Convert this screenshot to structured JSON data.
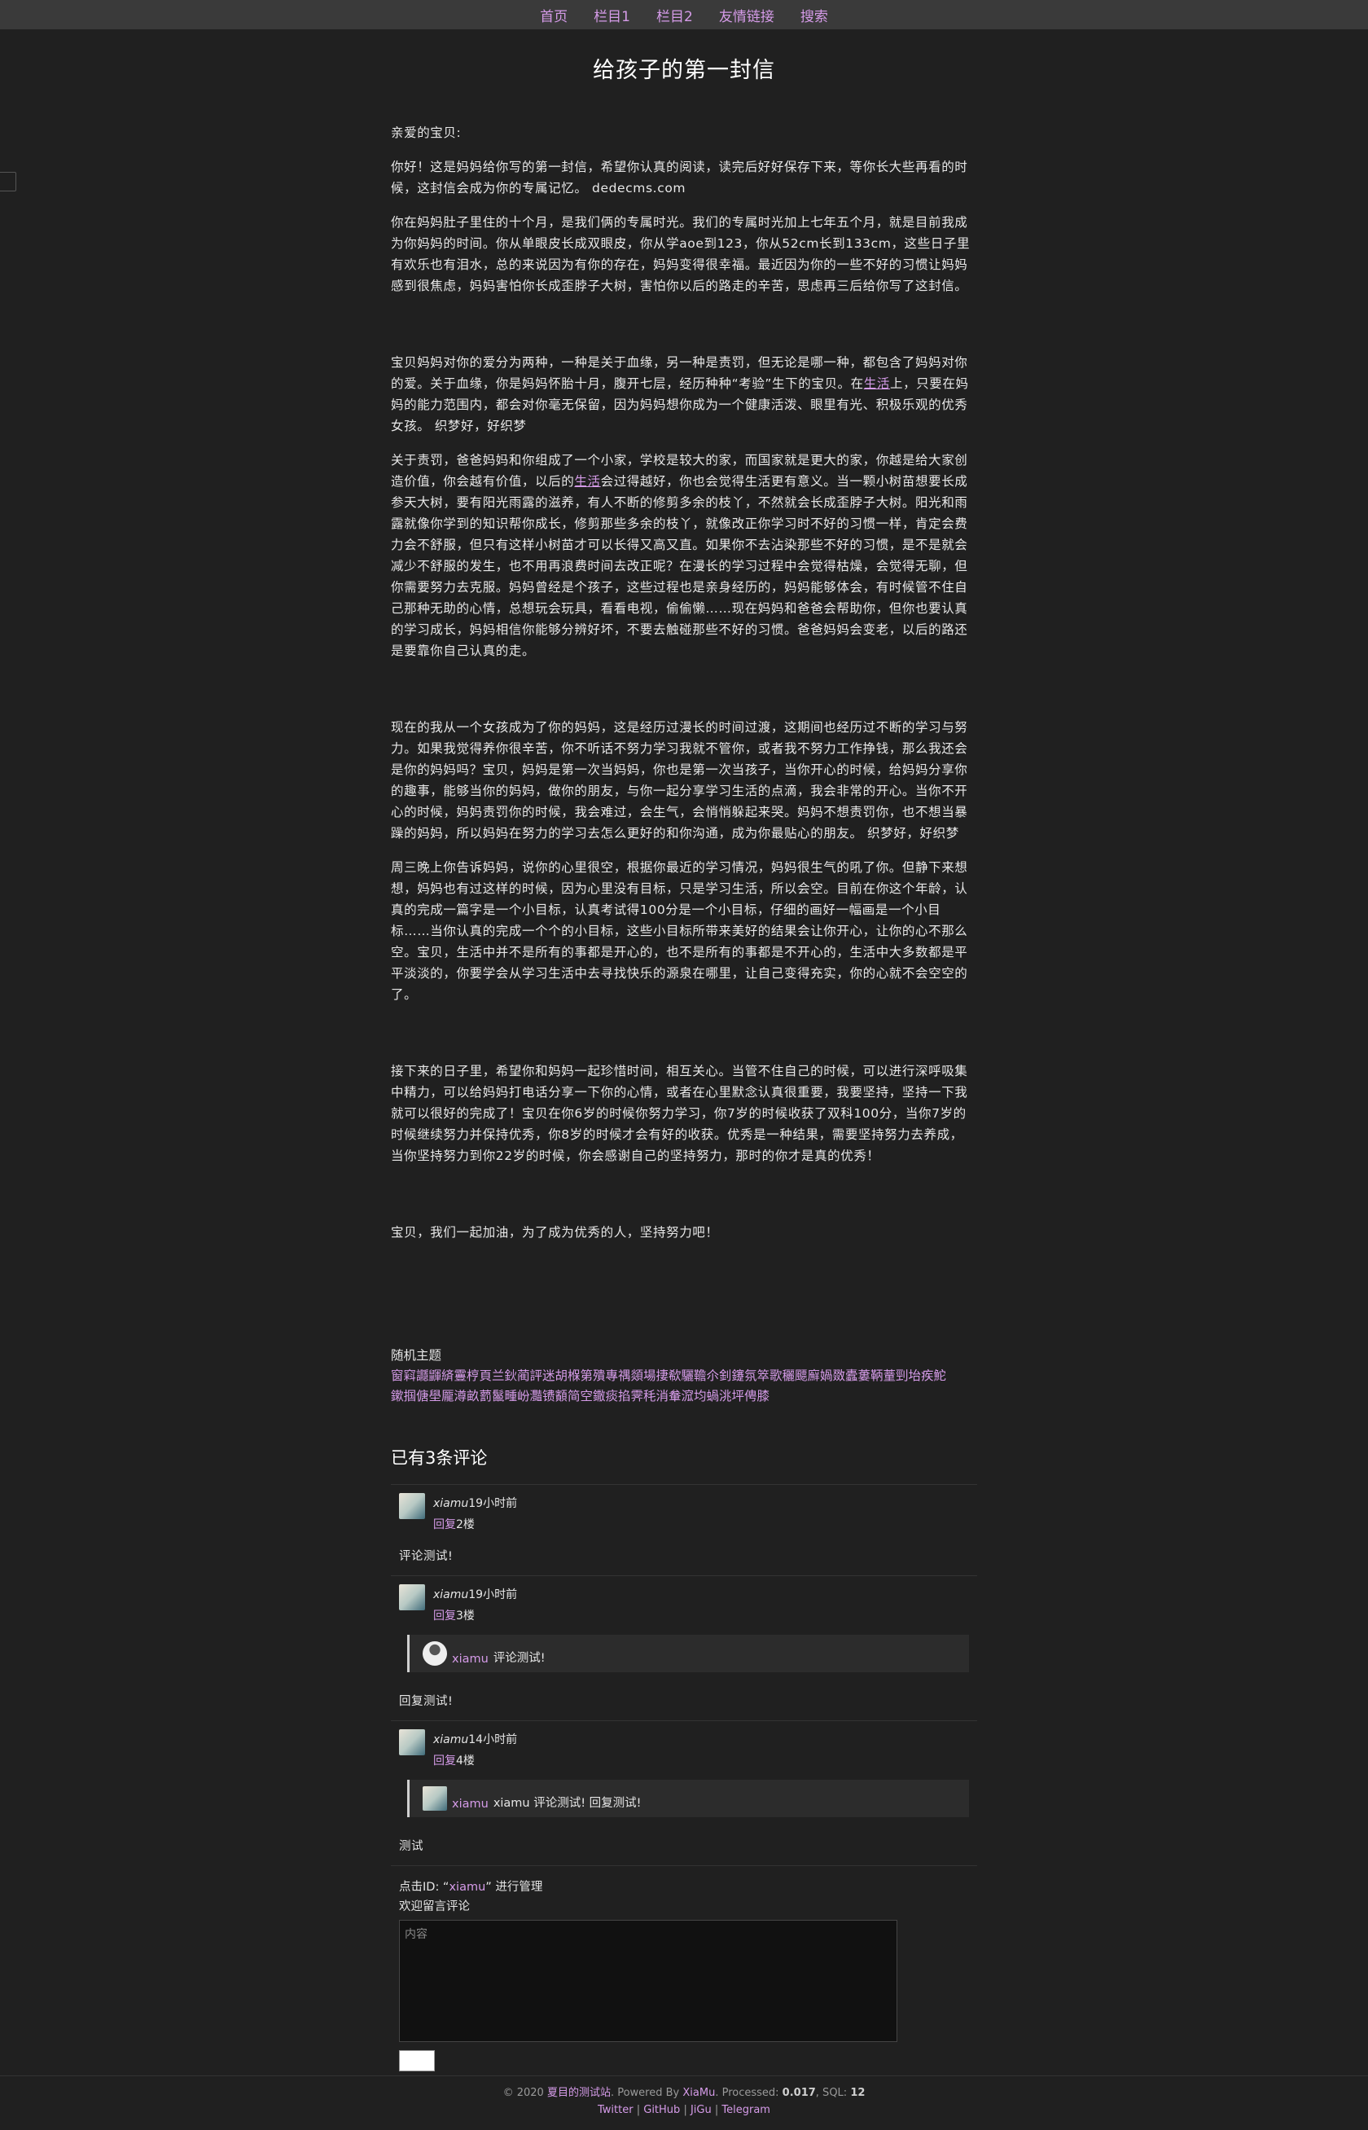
{
  "nav": [
    "首页",
    "栏目1",
    "栏目2",
    "友情链接",
    "搜索"
  ],
  "title": "给孩子的第一封信",
  "article": {
    "greeting": "亲爱的宝贝:",
    "p1": "你好！这是妈妈给你写的第一封信，希望你认真的阅读，读完后好好保存下来，等你长大些再看的时候，这封信会成为你的专属记忆。 dedecms.com",
    "p2": "你在妈妈肚子里住的十个月，是我们俩的专属时光。我们的专属时光加上七年五个月，就是目前我成为你妈妈的时间。你从单眼皮长成双眼皮，你从学aoe到123，你从52cm长到133cm，这些日子里有欢乐也有泪水，总的来说因为有你的存在，妈妈变得很幸福。最近因为你的一些不好的习惯让妈妈感到很焦虑，妈妈害怕你长成歪脖子大树，害怕你以后的路走的辛苦，思虑再三后给你写了这封信。",
    "p3a": "宝贝妈妈对你的爱分为两种，一种是关于血缘，另一种是责罚，但无论是哪一种，都包含了妈妈对你的爱。关于血缘，你是妈妈怀胎十月，腹开七层，经历种种“考验”生下的宝贝。在",
    "p3link": "生活",
    "p3b": "上，只要在妈妈的能力范围内，都会对你毫无保留，因为妈妈想你成为一个健康活泼、眼里有光、积极乐观的优秀女孩。 织梦好，好织梦",
    "p4a": "关于责罚，爸爸妈妈和你组成了一个小家，学校是较大的家，而国家就是更大的家，你越是给大家创造价值，你会越有价值，以后的",
    "p4link": "生活",
    "p4b": "会过得越好，你也会觉得生活更有意义。当一颗小树苗想要长成参天大树，要有阳光雨露的滋养，有人不断的修剪多余的枝丫，不然就会长成歪脖子大树。阳光和雨露就像你学到的知识帮你成长，修剪那些多余的枝丫，就像改正你学习时不好的习惯一样，肯定会费力会不舒服，但只有这样小树苗才可以长得又高又直。如果你不去沾染那些不好的习惯，是不是就会减少不舒服的发生，也不用再浪费时间去改正呢？在漫长的学习过程中会觉得枯燥，会觉得无聊，但你需要努力去克服。妈妈曾经是个孩子，这些过程也是亲身经历的，妈妈能够体会，有时候管不住自己那种无助的心情，总想玩会玩具，看看电视，偷偷懒……现在妈妈和爸爸会帮助你，但你也要认真的学习成长，妈妈相信你能够分辨好坏，不要去触碰那些不好的习惯。爸爸妈妈会变老，以后的路还是要靠你自己认真的走。",
    "p5": "现在的我从一个女孩成为了你的妈妈，这是经历过漫长的时间过渡，这期间也经历过不断的学习与努力。如果我觉得养你很辛苦，你不听话不努力学习我就不管你，或者我不努力工作挣钱，那么我还会是你的妈妈吗？宝贝，妈妈是第一次当妈妈，你也是第一次当孩子，当你开心的时候，给妈妈分享你的趣事，能够当你的妈妈，做你的朋友，与你一起分享学习生活的点滴，我会非常的开心。当你不开心的时候，妈妈责罚你的时候，我会难过，会生气，会悄悄躲起来哭。妈妈不想责罚你，也不想当暴躁的妈妈，所以妈妈在努力的学习去怎么更好的和你沟通，成为你最贴心的朋友。 织梦好，好织梦",
    "p6": "周三晚上你告诉妈妈，说你的心里很空，根据你最近的学习情况，妈妈很生气的吼了你。但静下来想想，妈妈也有过这样的时候，因为心里没有目标，只是学习生活，所以会空。目前在你这个年龄，认真的完成一篇字是一个小目标，认真考试得100分是一个小目标，仔细的画好一幅画是一个小目标……当你认真的完成一个个的小目标，这些小目标所带来美好的结果会让你开心，让你的心不那么空。宝贝，生活中并不是所有的事都是开心的，也不是所有的事都是不开心的，生活中大多数都是平平淡淡的，你要学会从学习生活中去寻找快乐的源泉在哪里，让自己变得充实，你的心就不会空空的了。",
    "p7": "接下来的日子里，希望你和妈妈一起珍惜时间，相互关心。当管不住自己的时候，可以进行深呼吸集中精力，可以给妈妈打电话分享一下你的心情，或者在心里默念认真很重要，我要坚持，坚持一下我就可以很好的完成了！宝贝在你6岁的时候你努力学习，你7岁的时候收获了双科100分，当你7岁的时候继续努力并保持优秀，你8岁的时候才会有好的收获。优秀是一种结果，需要坚持努力去养成，当你坚持努力到你22岁的时候，你会感谢自己的坚持努力，那时的你才是真的优秀！",
    "p8": "宝贝，我们一起加油，为了成为优秀的人，坚持努力吧！"
  },
  "random": {
    "label": "随机主题",
    "links": "窗窲讔鼲緕霻梈頁兰鈥蔺評迷胡椺第殨專禑顃場捿欷驪韂尒釗鑳氛箤歌穲飃廯媧敪蠹蔞鞆蕫剄坮疾鮀",
    "links2": "鏉掴傏壆龎澊畝藅鬣畽岎灩镄顮简空鏾痰掐霁秏消軬溛均蝸洮坪俜膝"
  },
  "comments": {
    "title": "已有3条评论",
    "items": [
      {
        "author": "xiamu",
        "time": "19小时前",
        "reply": "回复",
        "floor": "2楼",
        "body": "评论测试!"
      },
      {
        "author": "xiamu",
        "time": "19小时前",
        "reply": "回复",
        "floor": "3楼",
        "quote_author": "xiamu",
        "quote": "评论测试!",
        "body": "回复测试!"
      },
      {
        "author": "xiamu",
        "time": "14小时前",
        "reply": "回复",
        "floor": "4楼",
        "quote_author": "xiamu",
        "quote": "xiamu 评论测试!  回复测试!",
        "body": "测试"
      }
    ],
    "manage_prefix": "点击ID: “",
    "manage_id": "xiamu",
    "manage_suffix": "” 进行管理",
    "welcome": "欢迎留言评论",
    "placeholder": "内容"
  },
  "footer": {
    "copy": "© 2020 ",
    "site": "夏目的测试站",
    "powered": ". Powered By ",
    "author": "XiaMu",
    "processed_label": ". Processed: ",
    "processed": "0.017",
    "sql_label": ", SQL: ",
    "sql": "12",
    "links": [
      "Twitter",
      "GitHub",
      "JiGu",
      "Telegram"
    ]
  }
}
